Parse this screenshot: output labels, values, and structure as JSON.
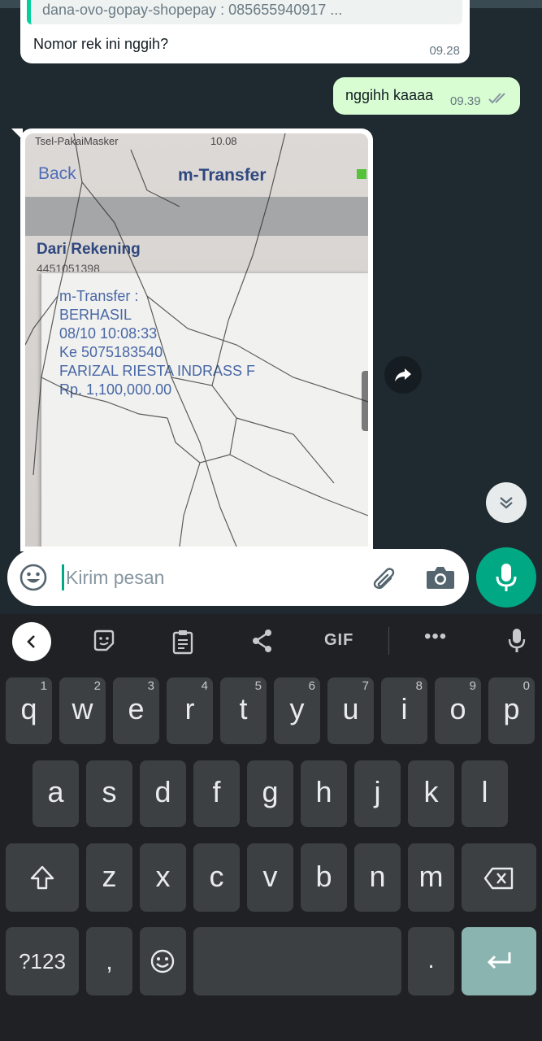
{
  "chat": {
    "quote_text": "dana-ovo-gopay-shopepay : 085655940917 ...",
    "incoming_text": "Nomor rek ini nggih?",
    "incoming_time": "09.28",
    "outgoing_text": "nggihh kaaaa",
    "outgoing_time": "09.39"
  },
  "photo": {
    "status": "Tsel-PakaiMasker",
    "clock": "10.08",
    "back_label": "Back",
    "title": "m-Transfer",
    "from_label": "Dari Rekening",
    "account_partial": "4451051398",
    "dialog_lines": [
      "m-Transfer :",
      "BERHASIL",
      "08/10 10:08:33",
      "Ke 5075183540",
      "FARIZAL RIESTA INDRASS F",
      "Rp. 1,100,000.00"
    ]
  },
  "composer": {
    "placeholder": "Kirim pesan"
  },
  "keyboard": {
    "gif_label": "GIF",
    "row1": [
      {
        "ch": "q",
        "num": "1"
      },
      {
        "ch": "w",
        "num": "2"
      },
      {
        "ch": "e",
        "num": "3"
      },
      {
        "ch": "r",
        "num": "4"
      },
      {
        "ch": "t",
        "num": "5"
      },
      {
        "ch": "y",
        "num": "6"
      },
      {
        "ch": "u",
        "num": "7"
      },
      {
        "ch": "i",
        "num": "8"
      },
      {
        "ch": "o",
        "num": "9"
      },
      {
        "ch": "p",
        "num": "0"
      }
    ],
    "row2": [
      "a",
      "s",
      "d",
      "f",
      "g",
      "h",
      "j",
      "k",
      "l"
    ],
    "row3": [
      "z",
      "x",
      "c",
      "v",
      "b",
      "n",
      "m"
    ],
    "symbols_label": "?123",
    "comma": ",",
    "period": "."
  },
  "colors": {
    "chat_bg": "#1f2a30",
    "incoming_bubble": "#ffffff",
    "outgoing_bubble": "#d9fdd3",
    "accent_green": "#00a884",
    "keyboard_bg": "#202124",
    "key_bg": "#3c4043",
    "enter_key": "#8ab4b0"
  },
  "icons": [
    "read-receipt-icon",
    "forward-icon",
    "scroll-down-icon",
    "emoji-icon",
    "attach-icon",
    "camera-icon",
    "mic-icon",
    "keyboard-back-icon",
    "sticker-icon",
    "clipboard-icon",
    "share-icon",
    "more-icon",
    "voice-input-icon",
    "shift-icon",
    "backspace-icon",
    "enter-icon"
  ]
}
